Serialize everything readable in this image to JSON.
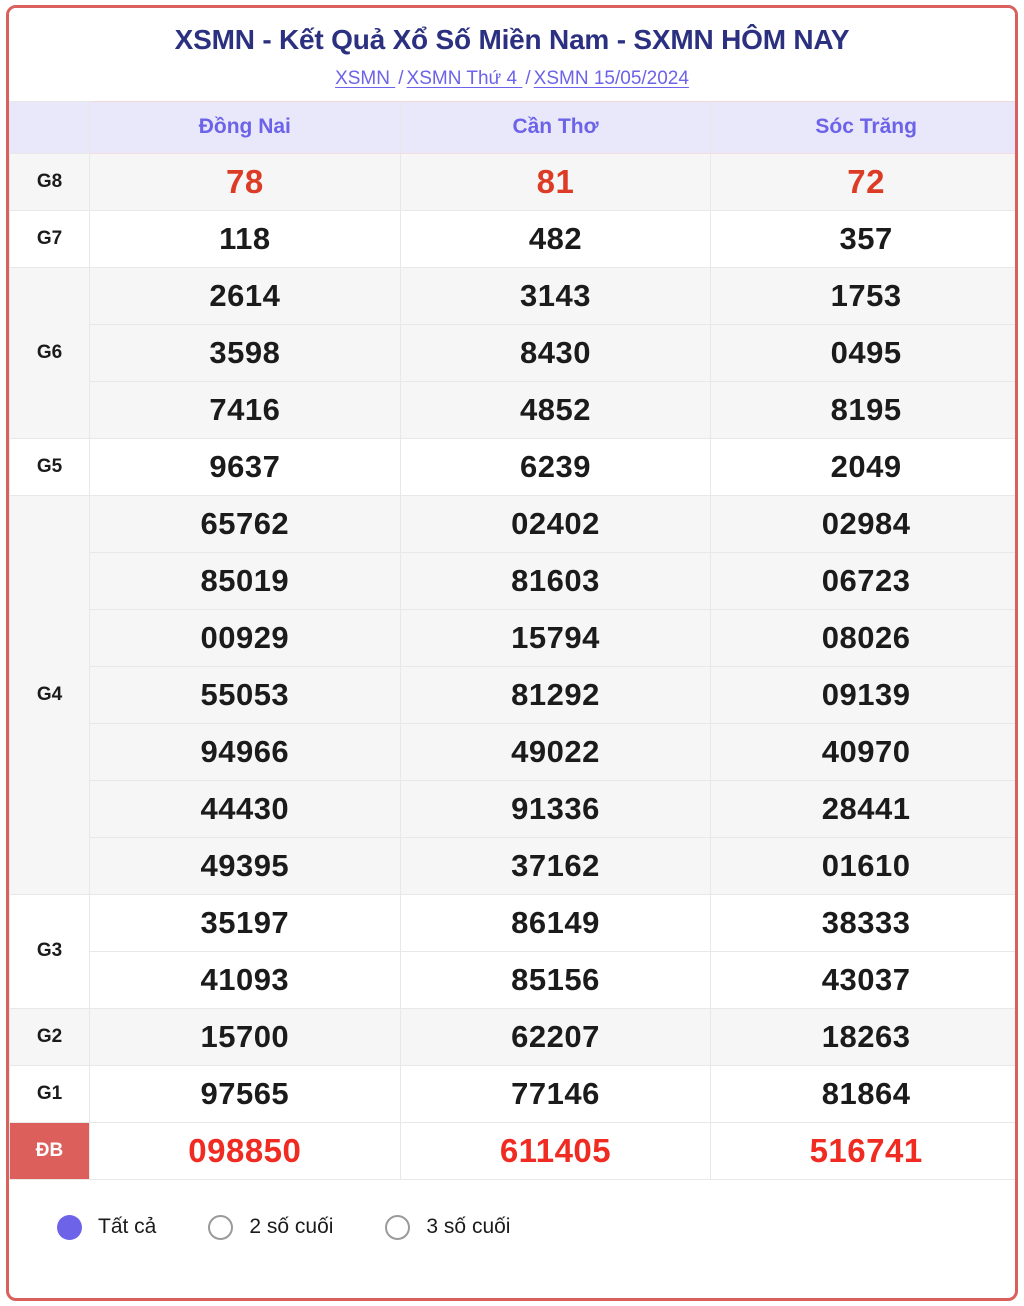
{
  "header": {
    "title": "XSMN - Kết Quả Xổ Số Miền Nam - SXMN HÔM NAY",
    "breadcrumb": {
      "item1": "XSMN ",
      "sep1": "/",
      "item2": "XSMN Thứ 4 ",
      "sep2": "/",
      "item3": "XSMN 15/05/2024"
    }
  },
  "table": {
    "corner_label": "",
    "provinces": [
      "Đồng Nai",
      "Cần Thơ",
      "Sóc Trăng"
    ],
    "prize_rows": [
      {
        "label": "G8",
        "rowspan": 1,
        "style": "g8",
        "values": [
          [
            "78",
            "81",
            "72"
          ]
        ]
      },
      {
        "label": "G7",
        "rowspan": 1,
        "style": "plain",
        "values": [
          [
            "118",
            "482",
            "357"
          ]
        ]
      },
      {
        "label": "G6",
        "rowspan": 3,
        "style": "alt",
        "values": [
          [
            "2614",
            "3143",
            "1753"
          ],
          [
            "3598",
            "8430",
            "0495"
          ],
          [
            "7416",
            "4852",
            "8195"
          ]
        ]
      },
      {
        "label": "G5",
        "rowspan": 1,
        "style": "plain",
        "values": [
          [
            "9637",
            "6239",
            "2049"
          ]
        ]
      },
      {
        "label": "G4",
        "rowspan": 7,
        "style": "alt",
        "values": [
          [
            "65762",
            "02402",
            "02984"
          ],
          [
            "85019",
            "81603",
            "06723"
          ],
          [
            "00929",
            "15794",
            "08026"
          ],
          [
            "55053",
            "81292",
            "09139"
          ],
          [
            "94966",
            "49022",
            "40970"
          ],
          [
            "44430",
            "91336",
            "28441"
          ],
          [
            "49395",
            "37162",
            "01610"
          ]
        ]
      },
      {
        "label": "G3",
        "rowspan": 2,
        "style": "plain",
        "values": [
          [
            "35197",
            "86149",
            "38333"
          ],
          [
            "41093",
            "85156",
            "43037"
          ]
        ]
      },
      {
        "label": "G2",
        "rowspan": 1,
        "style": "alt",
        "values": [
          [
            "15700",
            "62207",
            "18263"
          ]
        ]
      },
      {
        "label": "G1",
        "rowspan": 1,
        "style": "plain",
        "values": [
          [
            "97565",
            "77146",
            "81864"
          ]
        ]
      },
      {
        "label": "ĐB",
        "rowspan": 1,
        "style": "db",
        "values": [
          [
            "098850",
            "611405",
            "516741"
          ]
        ]
      }
    ]
  },
  "footer": {
    "options": [
      {
        "label": "Tất cả",
        "selected": true
      },
      {
        "label": "2 số cuối",
        "selected": false
      },
      {
        "label": "3 số cuối",
        "selected": false
      }
    ]
  },
  "colors": {
    "frame_border": "#d9605c",
    "title": "#2b3180",
    "accent_purple": "#6c63e8",
    "head_bg": "#e9e7fa",
    "special_red": "#ef2b22",
    "db_bg": "#dd5f5c"
  }
}
